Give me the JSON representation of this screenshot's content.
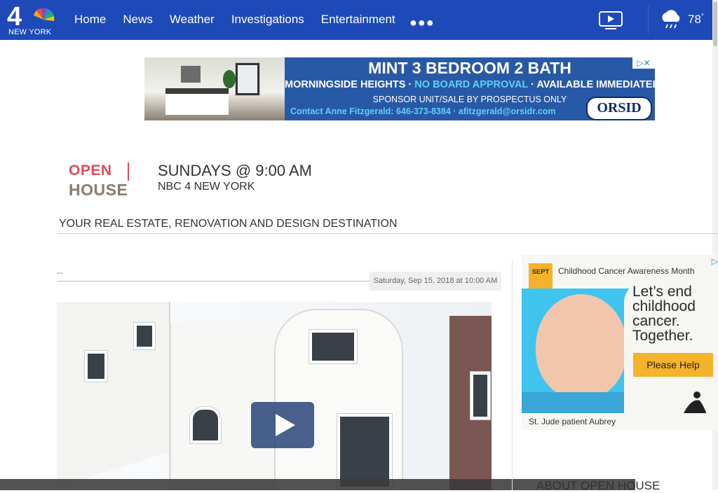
{
  "header": {
    "logo_text": "NEW YORK",
    "logo_number": "4",
    "nav": [
      "Home",
      "News",
      "Weather",
      "Investigations",
      "Entertainment"
    ],
    "more_icon": "ellipsis-icon",
    "temperature": "78",
    "temp_unit": "°"
  },
  "ad_banner": {
    "title": "MINT 3 BEDROOM 2 BATH",
    "line2_a": "MORNINGSIDE HEIGHTS · ",
    "line2_b": "NO BOARD APPROVAL",
    "line2_c": " · AVAILABLE IMMEDIATELY",
    "line3": "SPONSOR UNIT/SALE BY PROSPECTUS ONLY",
    "contact": "Contact Anne Fitzgerald: 646-373-8384 · afitzgerald@orsidr.com",
    "brand": "ORSID",
    "choice": "▷✕"
  },
  "show": {
    "logo_open": "OPEN",
    "logo_house": "HOUSE",
    "time": "SUNDAYS @ 9:00 AM",
    "station": "NBC 4 NEW YORK",
    "tagline": "YOUR REAL ESTATE, RENOVATION AND DESIGN DESTINATION"
  },
  "article": {
    "date": "Saturday, Sep 15, 2018 at 10:00 AM"
  },
  "side_ad": {
    "badge": "SEPT",
    "month_text": "Childhood Cancer Awareness Month",
    "headline": "Let’s end childhood cancer. Together.",
    "button": "Please Help",
    "caption": "St. Jude patient Aubrey",
    "choice": "▷"
  },
  "sidebar": {
    "heading": "ABOUT OPEN HOUSE"
  },
  "colors": {
    "nav_bg": "#1d4ab8",
    "ad_bg": "#2859a6",
    "accent_cyan": "#5fd0f5",
    "open_red": "#e04a5a",
    "button_yellow": "#f4b32a"
  }
}
